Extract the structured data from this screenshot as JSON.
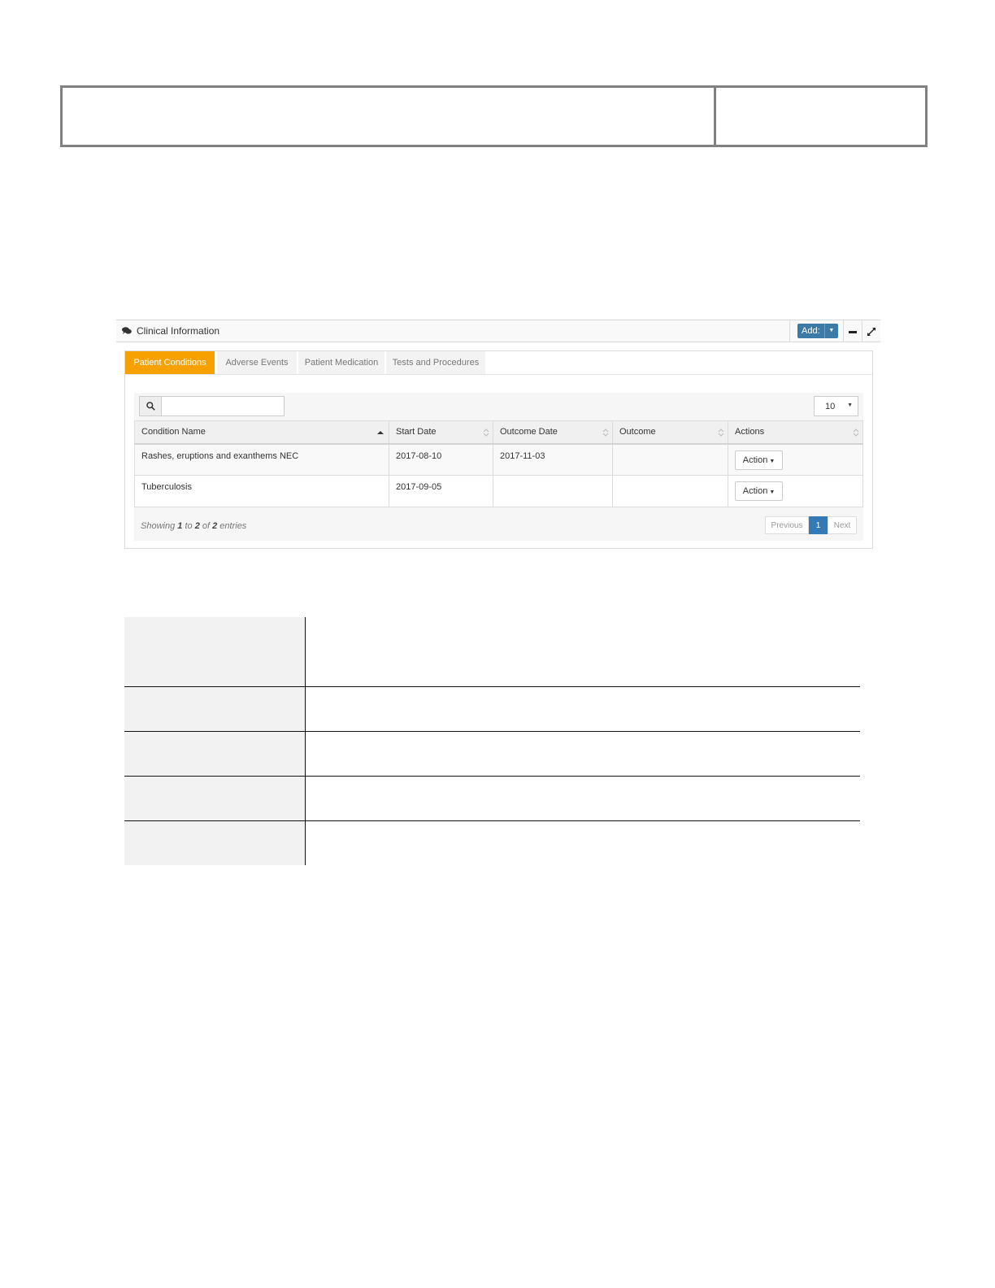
{
  "widget": {
    "title": "Clinical Information",
    "add_label": "Add:",
    "tabs": [
      {
        "label": "Patient Conditions",
        "active": true
      },
      {
        "label": "Adverse Events",
        "active": false
      },
      {
        "label": "Patient Medication",
        "active": false
      },
      {
        "label": "Tests and Procedures",
        "active": false
      }
    ],
    "search": {
      "value": "",
      "placeholder": ""
    },
    "page_length": "10",
    "columns": [
      "Condition Name",
      "Start Date",
      "Outcome Date",
      "Outcome",
      "Actions"
    ],
    "rows": [
      {
        "condition": "Rashes, eruptions and exanthems NEC",
        "start": "2017-08-10",
        "outcome_date": "2017-11-03",
        "outcome": "",
        "action": "Action"
      },
      {
        "condition": "Tuberculosis",
        "start": "2017-09-05",
        "outcome_date": "",
        "outcome": "",
        "action": "Action"
      }
    ],
    "info": {
      "prefix": "Showing ",
      "from": "1",
      "to_word": " to ",
      "to": "2",
      "of_word": " of ",
      "total": "2",
      "suffix": " entries"
    },
    "pager": {
      "previous": "Previous",
      "current": "1",
      "next": "Next"
    }
  },
  "colors": {
    "tab_active": "#f7a100",
    "add_button": "#3c7ba8",
    "page_current": "#337ab7"
  }
}
